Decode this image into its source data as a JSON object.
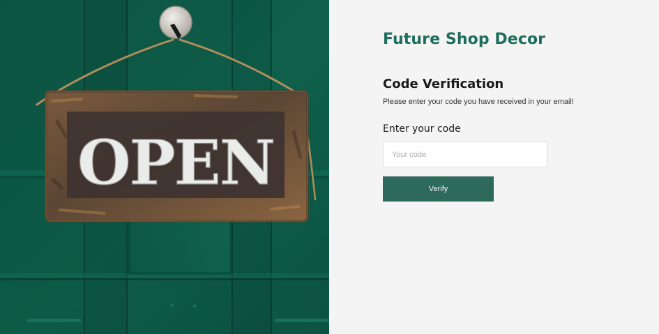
{
  "page": {
    "brand": "Future Shop Decor",
    "title": "Code Verification",
    "subtitle": "Please enter your code you have received in your email!",
    "field_label": "Enter your code",
    "input_placeholder": "Your code",
    "input_value": "",
    "button_label": "Verify"
  },
  "hero": {
    "sign_text": "OPEN"
  },
  "colors": {
    "brand": "#1e6e5b",
    "button": "#2d6a5b",
    "panel_bg": "#f4f4f4",
    "door_green": "#0f5d49"
  },
  "icons": {
    "hero_image": "open-sign-photo"
  }
}
